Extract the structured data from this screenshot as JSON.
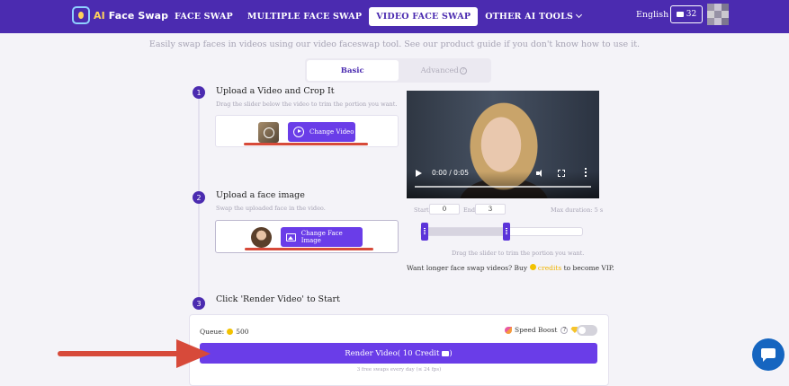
{
  "brand": {
    "name_prefix": "AI",
    "name_rest": " Face Swap"
  },
  "nav": {
    "items": [
      {
        "label": "FACE SWAP"
      },
      {
        "label": "MULTIPLE FACE SWAP"
      },
      {
        "label": "VIDEO FACE SWAP",
        "active": true
      },
      {
        "label": "OTHER AI TOOLS"
      }
    ],
    "language": "English",
    "credits": "32"
  },
  "subtitle": "Easily swap faces in videos using our video faceswap tool. See our product guide if you don't know how to use it.",
  "tabs": {
    "basic": "Basic",
    "advanced": "Advanced",
    "advanced_help": "?"
  },
  "steps": [
    {
      "num": "1",
      "title": "Upload a Video and Crop It",
      "desc": "Drag the slider below the video to trim the portion you want.",
      "button": "Change Video"
    },
    {
      "num": "2",
      "title": "Upload a face image",
      "desc": "Swap the uploaded face in the video.",
      "button": "Change Face Image"
    },
    {
      "num": "3",
      "title": "Click 'Render Video' to Start"
    }
  ],
  "player": {
    "time": "0:00 / 0:05",
    "progress": 0
  },
  "trim": {
    "start_label": "Start:",
    "start_value": "0",
    "end_label": "End:",
    "end_value": "3",
    "max_duration": "Max duration: 5 s",
    "hint": "Drag the slider to trim the portion you want.",
    "range_start_fraction": 0,
    "range_end_fraction": 0.6
  },
  "vip": {
    "prefix": "Want longer face swap videos? Buy",
    "link": "credits",
    "suffix": "to become VIP."
  },
  "render": {
    "queue_label": "Queue:",
    "queue_value": "500",
    "speed_boost": "Speed Boost",
    "button": "Render Video( 10 Credit",
    "button_end": " )",
    "free_note": "3 free swaps every day (≤ 24 fps)"
  },
  "colors": {
    "brand": "#4b2bb0",
    "accent": "#6a3de8",
    "annotation": "#d74a3a",
    "chat": "#1565c0"
  }
}
